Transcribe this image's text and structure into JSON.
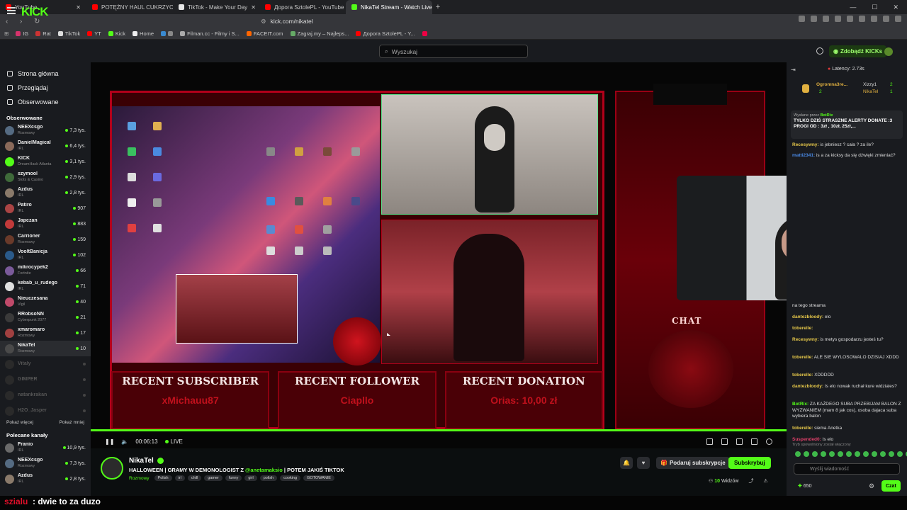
{
  "browser": {
    "tabs": [
      {
        "label": "YouTube",
        "color": "#ff0000"
      },
      {
        "label": "POTĘŻNY HAUL CUKRZYCOWY - ile k",
        "color": "#ff0000"
      },
      {
        "label": "TikTok - Make Your Day",
        "color": "#e6e6e6"
      },
      {
        "label": "Дорога SztolePL - YouTube",
        "color": "#ff0000"
      },
      {
        "label": "NikaTel Stream - Watch Live o",
        "color": "#53fc18",
        "active": true
      }
    ],
    "url": "kick.com/nikatel",
    "bookmarks": [
      "IG",
      "Rat",
      "TikTok",
      "YT",
      "Kick",
      "Home",
      "Filman.cc - Filmy i S...",
      "FACEIT.com",
      "Zagraj.my – Najleps...",
      "Дорога SztolePL - Y..."
    ]
  },
  "topbar": {
    "logo": "KICK",
    "search_placeholder": "Wyszukaj",
    "get_kicks": "Zdobądź KICKs"
  },
  "sidebar": {
    "nav": [
      {
        "label": "Strona główna"
      },
      {
        "label": "Przeglądaj"
      },
      {
        "label": "Obserwowane"
      }
    ],
    "followed_title": "Obserwowane",
    "followed": [
      {
        "name": "NEEXcsgo",
        "cat": "Rozmowy",
        "viewers": "7,3 tys.",
        "color": "#556b82"
      },
      {
        "name": "DanielMagical",
        "cat": "IRL",
        "viewers": "6,4 tys.",
        "color": "#8a6a5a"
      },
      {
        "name": "KICK",
        "cat": "DreamHack Atlanta",
        "viewers": "3,1 tys.",
        "color": "#53fc18"
      },
      {
        "name": "szymool",
        "cat": "Slots & Casino",
        "viewers": "2,9 tys.",
        "color": "#3f6a3a"
      },
      {
        "name": "Azdus",
        "cat": "IRL",
        "viewers": "2,8 tys.",
        "color": "#8a7a6a"
      },
      {
        "name": "Patiro",
        "cat": "IRL",
        "viewers": "907",
        "color": "#aa4444"
      },
      {
        "name": "Japczan",
        "cat": "IRL",
        "viewers": "883",
        "color": "#c23a3a"
      },
      {
        "name": "Carrioner",
        "cat": "Rozmowy",
        "viewers": "159",
        "color": "#6a3a2a"
      },
      {
        "name": "VooltBanicja",
        "cat": "IRL",
        "viewers": "102",
        "color": "#2a5a8a"
      },
      {
        "name": "mikrocypek2",
        "cat": "Fortnite",
        "viewers": "66",
        "color": "#7a5a9a"
      },
      {
        "name": "kebab_u_rudego",
        "cat": "IRL",
        "viewers": "71",
        "color": "#e0e0e0"
      },
      {
        "name": "Nieuczesana",
        "cat": "Vigil",
        "viewers": "40",
        "color": "#c04a6a"
      },
      {
        "name": "RRobsoNN",
        "cat": "Cyberpunk 2077",
        "viewers": "21",
        "color": "#3a3a3a"
      },
      {
        "name": "xmaromaro",
        "cat": "Rozmowy",
        "viewers": "17",
        "color": "#a04040"
      },
      {
        "name": "NikaTel",
        "cat": "Rozmowy",
        "viewers": "10",
        "color": "#4a4a4a",
        "selected": true
      },
      {
        "name": "Vitaly",
        "cat": "",
        "viewers": "",
        "offline": true,
        "color": "#2a2a2a"
      },
      {
        "name": "GIMPER",
        "cat": "",
        "viewers": "",
        "offline": true,
        "color": "#2a2a2a"
      },
      {
        "name": "natankrakan",
        "cat": "",
        "viewers": "",
        "offline": true,
        "color": "#2a2a2a"
      },
      {
        "name": "H2O_Jasper",
        "cat": "",
        "viewers": "",
        "offline": true,
        "color": "#2a2a2a"
      }
    ],
    "show_more": "Pokaż więcej",
    "show_less": "Pokaż mniej",
    "recommended_title": "Polecane kanały",
    "recommended": [
      {
        "name": "Franio",
        "cat": "IRL",
        "viewers": "10,9 tys.",
        "color": "#6a6a6a"
      },
      {
        "name": "NEEXcsgo",
        "cat": "Rozmowy",
        "viewers": "7,3 tys.",
        "color": "#556b82"
      },
      {
        "name": "Azdus",
        "cat": "IRL",
        "viewers": "2,8 tys.",
        "color": "#8a7a6a"
      }
    ]
  },
  "overlay": {
    "recent_subscriber_title": "RECENT SUBSCRIBER",
    "recent_subscriber": "xMichauu87",
    "recent_follower_title": "RECENT FOLLOWER",
    "recent_follower": "Ciapllo",
    "recent_donation_title": "RECENT DONATION",
    "recent_donation": "Orias: 10,00 zł",
    "chat_label": "CHAT"
  },
  "player": {
    "time": "00:06:13",
    "live": "LIVE",
    "progress": 1.0
  },
  "stream": {
    "channel": "NikaTel",
    "title_prefix": "HALLOWEEN | GRAMY W DEMONOLOGIST Z ",
    "title_mention": "@anetamaksio",
    "title_suffix": " | POTEM JAKIŚ TIKTOK",
    "category": "Rozmowy",
    "tags": [
      "Polish",
      "irl",
      "chill",
      "gamer",
      "funny",
      "girl",
      "polish",
      "cooking",
      "GOTOWANIE"
    ],
    "gift_label": "Podaruj subskrypcje",
    "subscribe_label": "Subskrybuj",
    "viewers_count": "10",
    "viewers_label": "Widzów"
  },
  "chat": {
    "latency": "Latency: 2.73s",
    "leaderboard": [
      {
        "name": "Ogromna3re...",
        "value": "2"
      },
      {
        "name": "Xizzy1",
        "value": "2"
      },
      {
        "name": "NikaTel",
        "value": "1"
      }
    ],
    "pinned_by": "Wysłane przez",
    "pinned_author": "BotRix",
    "pinned_text": "TYLKO DZIŚ STRASZNE ALERTY DONATE :3 PROGI OD : 3zł , 10zł, 25zł,...",
    "messages_top": [
      {
        "user": "Recesywny:",
        "text": " is jebniesz ? cała ? za ile?",
        "color": "#e6c84a"
      },
      {
        "user": "matti2341:",
        "text": " is a za kicksy da się dźwięki zmieniać?",
        "color": "#4a8ae6"
      }
    ],
    "messages": [
      {
        "user": "",
        "text": "na tego streama",
        "color": "#ddd"
      },
      {
        "user": "dantezbloody:",
        "text": " elo",
        "color": "#e6c84a"
      },
      {
        "user": "toberelle:",
        "text": " ",
        "color": "#e6c84a"
      },
      {
        "user": "Recesywny:",
        "text": " is metys gospodarzu jesteś tu?",
        "color": "#e6c84a"
      },
      {
        "user": "toberelle:",
        "text": " ALE SIE WYLOSOWALO DZISIAJ XDDD",
        "color": "#e6c84a"
      },
      {
        "user": "toberelle:",
        "text": " XDDDDD",
        "color": "#e6c84a"
      },
      {
        "user": "dantezbloody:",
        "text": " Is elo nowak ruchał kure widziales?",
        "color": "#e6c84a"
      },
      {
        "user": "BotRix:",
        "text": " ZA KAŻDEGO SUBA PRZEBIJAM BALON Z WYZWANIEM (mam 8 jak cos), osoba dajaca suba wybiera balon",
        "color": "#53fc18"
      },
      {
        "user": "toberelle:",
        "text": " siema Anetka",
        "color": "#e6c84a"
      },
      {
        "user": "Suspended0:",
        "text": " Is elo",
        "color": "#e0406a"
      }
    ],
    "slow_mode": "Tryb spowolniony został włączony",
    "input_placeholder": "Wyślij wiadomość",
    "balance": "650",
    "send_label": "Czat"
  },
  "caption": {
    "user": "szialu",
    "text": ": dwie to za duzo"
  }
}
